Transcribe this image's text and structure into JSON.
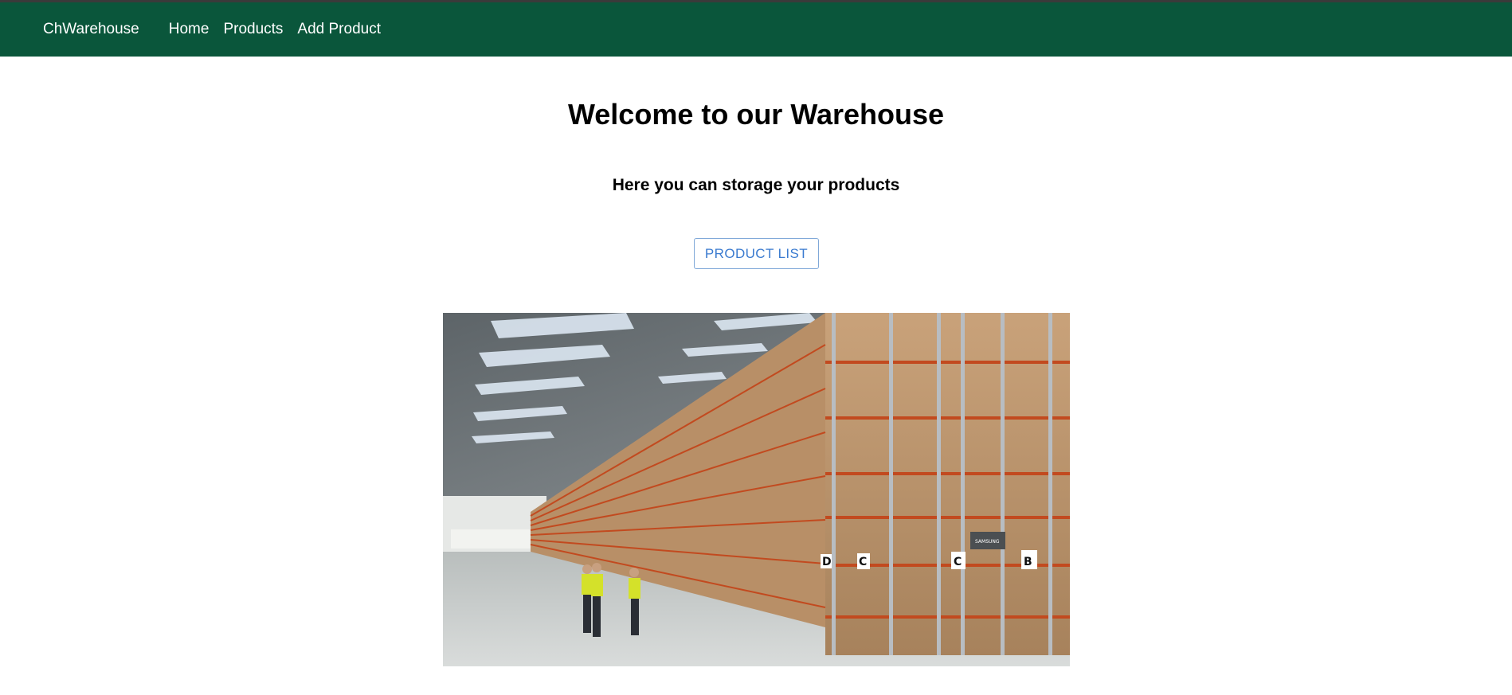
{
  "navbar": {
    "brand": "ChWarehouse",
    "links": [
      "Home",
      "Products",
      "Add Product"
    ],
    "background_color": "#0a563b"
  },
  "hero": {
    "title": "Welcome to our Warehouse",
    "subtitle": "Here you can storage your products",
    "button_label": "PRODUCT LIST",
    "button_color": "#3b7bd0"
  },
  "image": {
    "aisle_labels": [
      "D",
      "C",
      "C",
      "B"
    ],
    "sign_text": "SAMSUNG"
  }
}
